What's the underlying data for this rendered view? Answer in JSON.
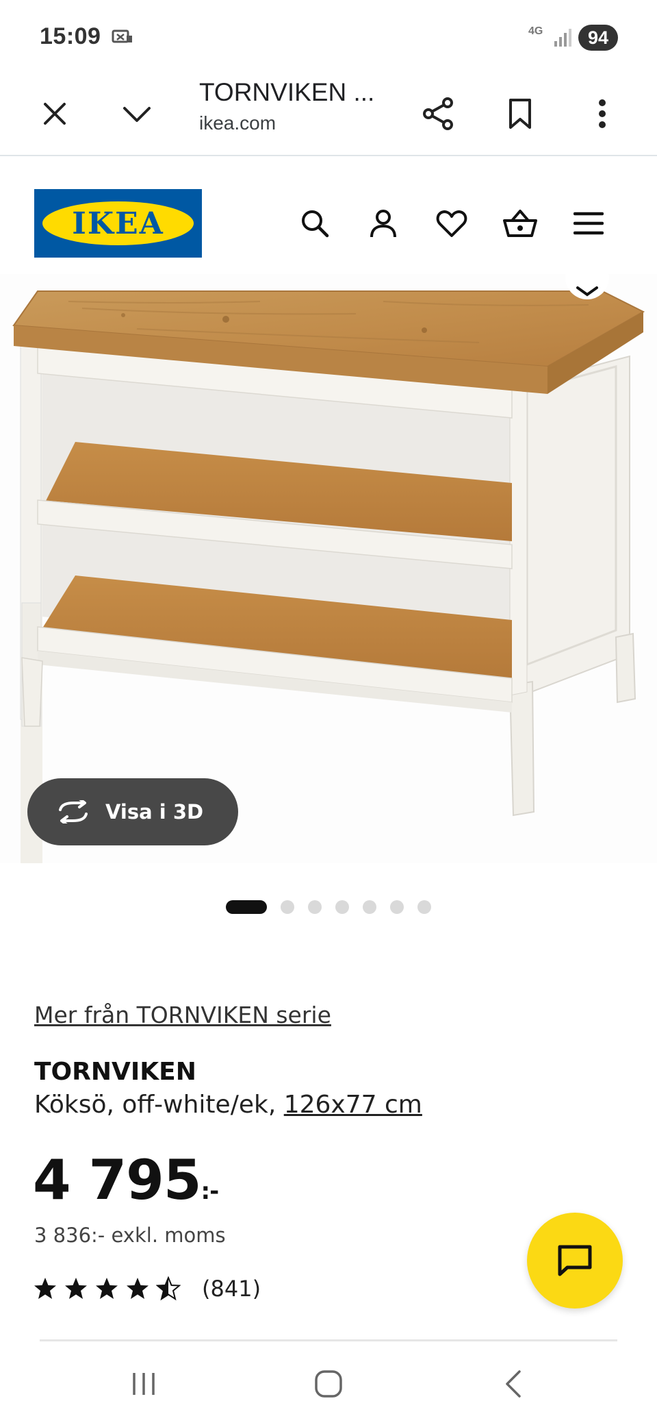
{
  "status_bar": {
    "time": "15:09",
    "network": "4G",
    "battery": "94"
  },
  "browser": {
    "title": "TORNVIKEN ...",
    "url": "ikea.com"
  },
  "header": {
    "logo_text": "IKEA"
  },
  "product_image": {
    "view_3d_label": "Visa i 3D",
    "gallery_pages": 7,
    "gallery_active_index": 0
  },
  "product": {
    "series_link": "Mer från TORNVIKEN serie",
    "name": "TORNVIKEN",
    "description": "Köksö, off-white/ek, ",
    "size_link": "126x77 cm",
    "price": "4 795",
    "price_suffix": ":-",
    "price_exkl": "3 836:- exkl. moms",
    "rating_stars": 4.5,
    "rating_count": "(841)"
  },
  "colors": {
    "ikea_blue": "#0058a3",
    "ikea_yellow": "#ffdb00",
    "chat_yellow": "#fbd914",
    "button_dark": "#484848",
    "wood": "#c89652"
  }
}
